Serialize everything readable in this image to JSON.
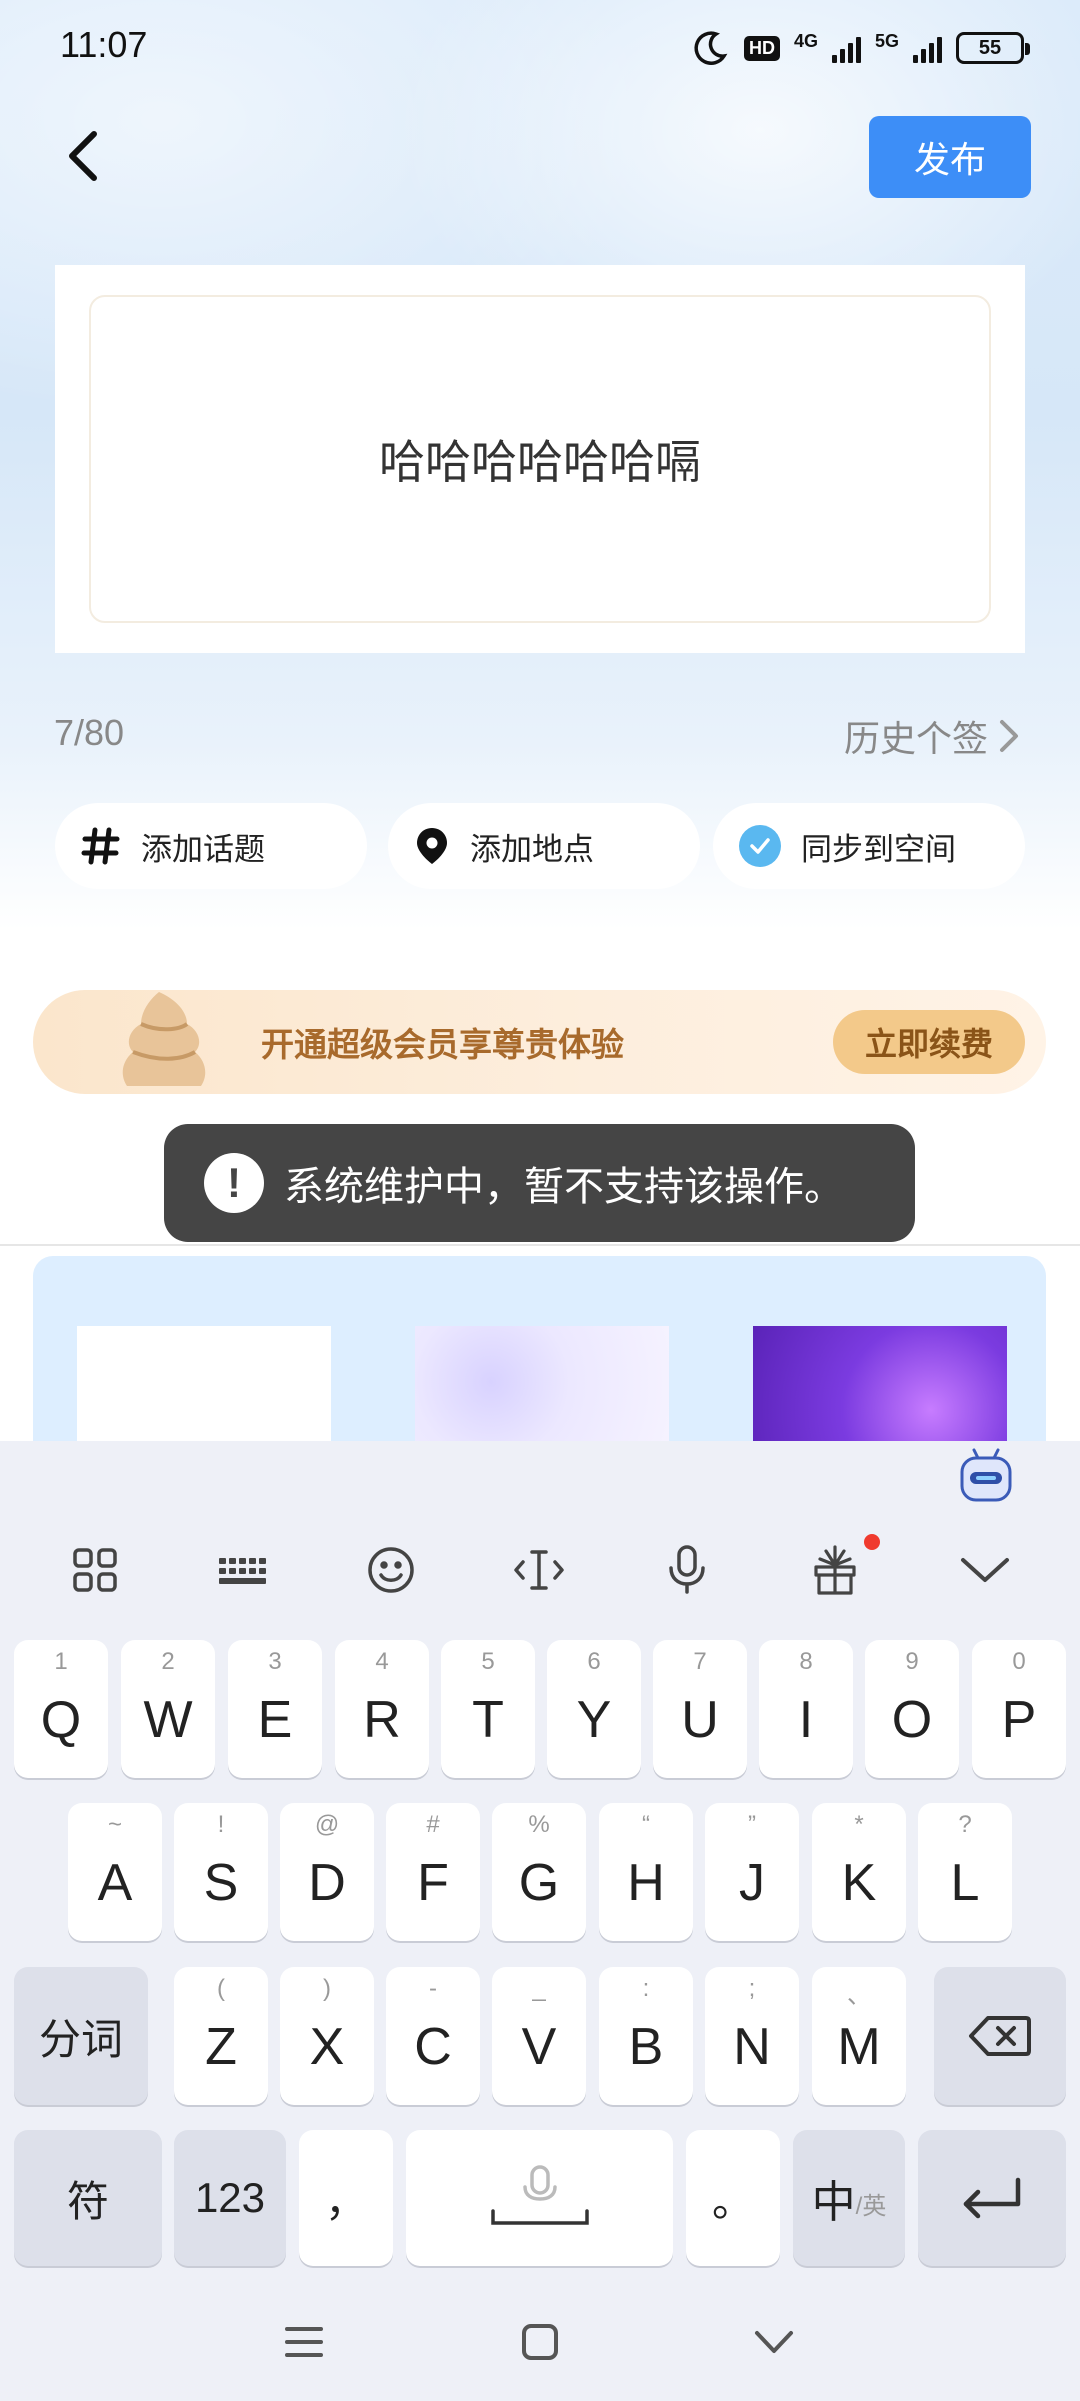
{
  "status_bar": {
    "time": "11:07",
    "network_hd": "HD",
    "network_4g": "4G",
    "network_5g": "5G",
    "battery": "55"
  },
  "header": {
    "publish_label": "发布"
  },
  "signature": {
    "text": "哈哈哈哈哈哈嗝",
    "char_count": "7/80",
    "history_label": "历史个签"
  },
  "chips": {
    "topic_label": "添加话题",
    "location_label": "添加地点",
    "sync_label": "同步到空间"
  },
  "vip": {
    "text": "开通超级会员享尊贵体验",
    "button_label": "立即续费",
    "accent": "#f3c98a"
  },
  "toast": {
    "message": "系统维护中，暂不支持该操作。"
  },
  "keyboard": {
    "row1": [
      {
        "main": "Q",
        "sub": "1"
      },
      {
        "main": "W",
        "sub": "2"
      },
      {
        "main": "E",
        "sub": "3"
      },
      {
        "main": "R",
        "sub": "4"
      },
      {
        "main": "T",
        "sub": "5"
      },
      {
        "main": "Y",
        "sub": "6"
      },
      {
        "main": "U",
        "sub": "7"
      },
      {
        "main": "I",
        "sub": "8"
      },
      {
        "main": "O",
        "sub": "9"
      },
      {
        "main": "P",
        "sub": "0"
      }
    ],
    "row2": [
      {
        "main": "A",
        "sub": "~"
      },
      {
        "main": "S",
        "sub": "!"
      },
      {
        "main": "D",
        "sub": "@"
      },
      {
        "main": "F",
        "sub": "#"
      },
      {
        "main": "G",
        "sub": "%"
      },
      {
        "main": "H",
        "sub": "“"
      },
      {
        "main": "J",
        "sub": "”"
      },
      {
        "main": "K",
        "sub": "*"
      },
      {
        "main": "L",
        "sub": "?"
      }
    ],
    "row3": [
      {
        "main": "Z",
        "sub": "("
      },
      {
        "main": "X",
        "sub": ")"
      },
      {
        "main": "C",
        "sub": "-"
      },
      {
        "main": "V",
        "sub": "_"
      },
      {
        "main": "B",
        "sub": ":"
      },
      {
        "main": "N",
        "sub": ";"
      },
      {
        "main": "M",
        "sub": "、"
      }
    ],
    "segment_label": "分词",
    "symbol_label": "符",
    "numbers_label": "123",
    "comma_label": "，",
    "period_label": "。",
    "lang_main": "中",
    "lang_sub": "/英"
  },
  "colors": {
    "primary": "#3d8ef7",
    "toast_bg": "#454545",
    "keyboard_bg": "#eef0f7"
  }
}
